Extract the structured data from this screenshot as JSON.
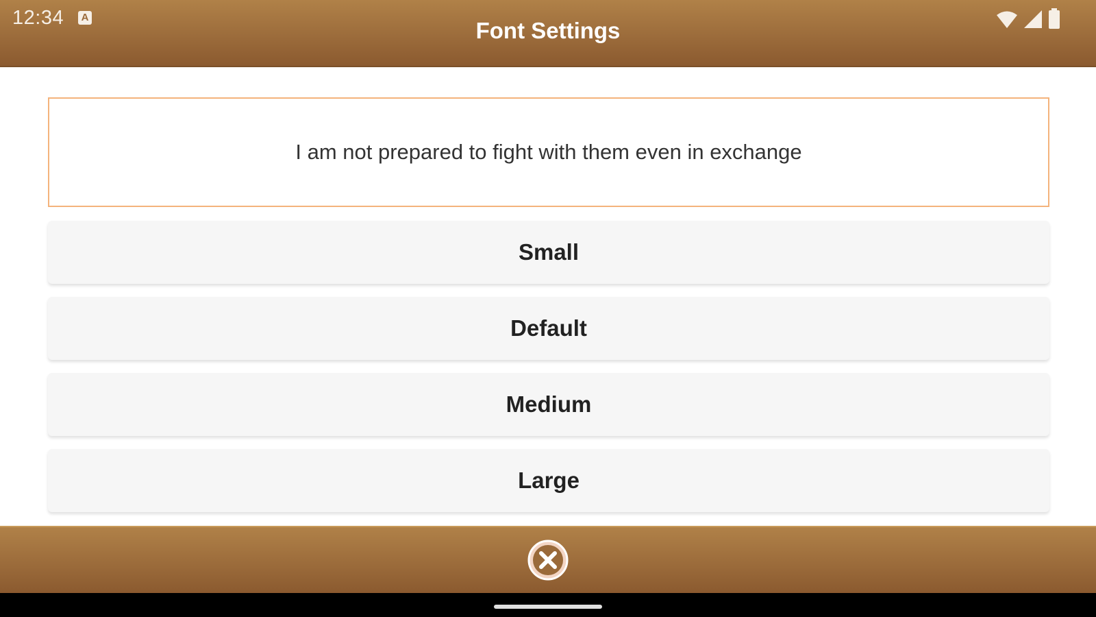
{
  "status_bar": {
    "time": "12:34",
    "indicator": "A",
    "icons": [
      "wifi-icon",
      "signal-icon",
      "battery-icon"
    ]
  },
  "header": {
    "title": "Font Settings"
  },
  "preview": {
    "text": "I am not prepared to fight with them even in exchange"
  },
  "options": [
    {
      "label": "Small"
    },
    {
      "label": "Default"
    },
    {
      "label": "Medium"
    },
    {
      "label": "Large"
    }
  ],
  "footer": {
    "close_icon": "close-circle-icon"
  },
  "colors": {
    "bar_top": "#b08148",
    "bar_bottom": "#8b5a2f",
    "preview_border": "#f4b37c",
    "option_bg": "#f6f6f6"
  }
}
